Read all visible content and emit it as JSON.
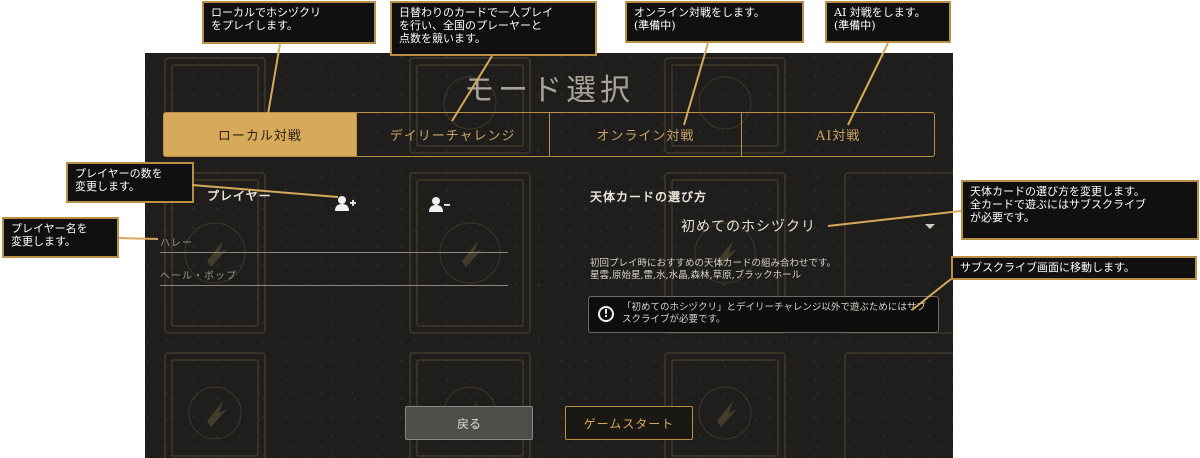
{
  "screen": {
    "title": "モード選択",
    "tabs": [
      {
        "label": "ローカル対戦",
        "active": true
      },
      {
        "label": "デイリーチャレンジ",
        "active": false
      },
      {
        "label": "オンライン対戦",
        "active": false
      },
      {
        "label": "AI対戦",
        "active": false
      }
    ],
    "players": {
      "label": "プレイヤー",
      "add_icon": "add-person-icon",
      "remove_icon": "remove-person-icon",
      "names": [
        "ハレー",
        "ヘール・ボップ"
      ]
    },
    "card_set": {
      "label": "天体カードの選び方",
      "selected": "初めてのホシヅクリ",
      "description": "初回プレイ時におすすめの天体カードの組み合わせです。",
      "cards": "星雲,原始星,雷,水,水晶,森林,草原,ブラックホール",
      "notice": "「初めてのホシヅクリ」とデイリーチャレンジ以外で遊ぶためにはサブスクライブが必要です。"
    },
    "buttons": {
      "back": "戻る",
      "start": "ゲームスタート"
    }
  },
  "annotations": {
    "local": [
      "ローカルでホシヅクリ",
      "をプレイします。"
    ],
    "daily": [
      "日替わりのカードで一人プレイ",
      "を行い、全国のプレーヤーと",
      "点数を競います。"
    ],
    "online": [
      "オンライン対戦をします。",
      "(準備中)"
    ],
    "ai": [
      "AI 対戦をします。",
      "(準備中)"
    ],
    "player_count": [
      "プレイヤーの数を",
      "変更します。"
    ],
    "player_name": [
      "プレイヤー名を",
      "変更します。"
    ],
    "card_method": [
      "天体カードの選び方を変更します。",
      "全カードで遊ぶにはサブスクライブ",
      "が必要です。"
    ],
    "subscribe": [
      "サブスクライブ画面に移動します。"
    ]
  },
  "colors": {
    "accent": "#d7a95a",
    "background": "#1f1e1c",
    "callout_border": "#b98f45"
  }
}
